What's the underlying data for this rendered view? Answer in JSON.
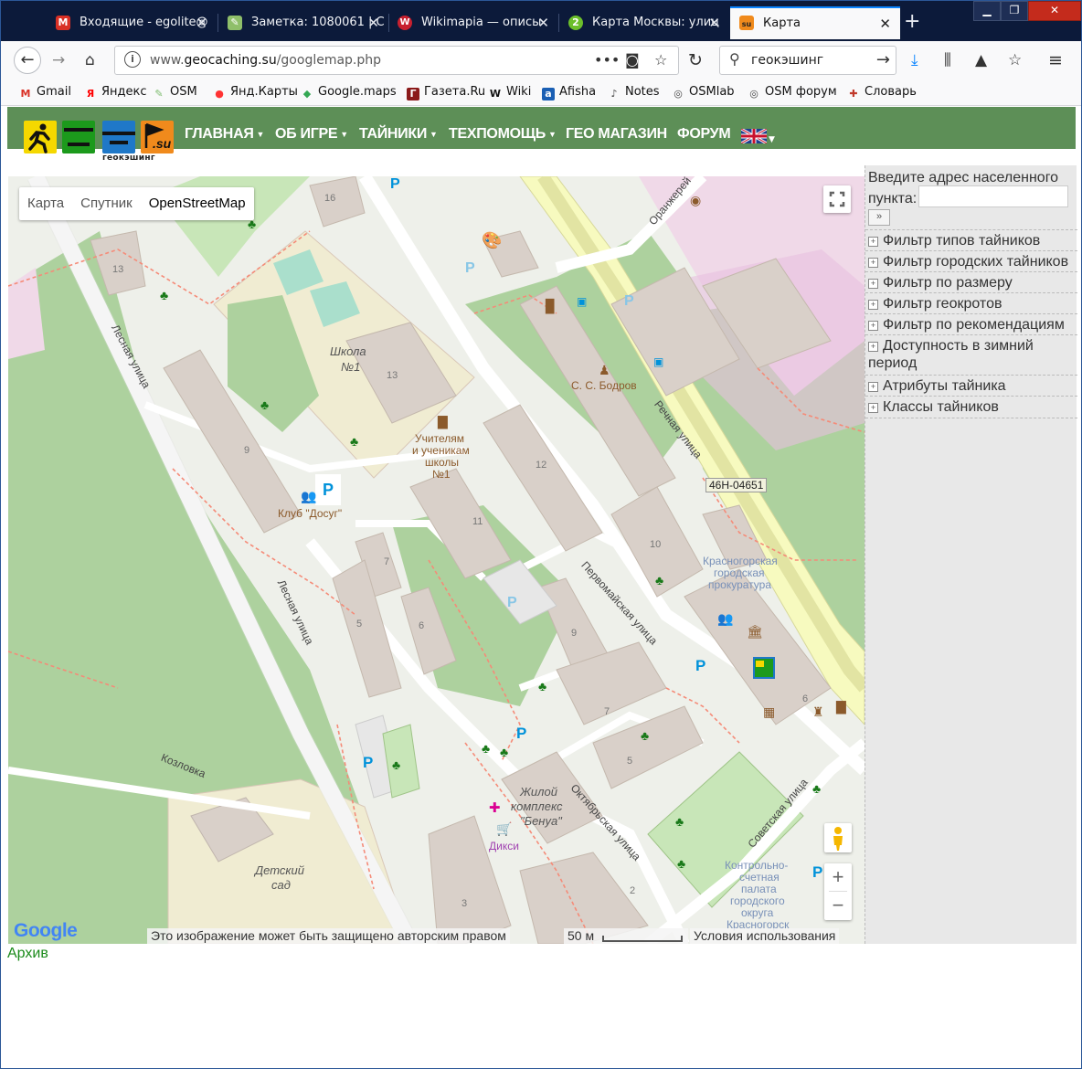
{
  "browser": {
    "tabs": [
      {
        "title": "Входящие - egolite@",
        "favicon_color": "#d93025",
        "favicon_glyph": "M"
      },
      {
        "title": "Заметка: 1080061 | С",
        "favicon_color": "#8fbf6a",
        "favicon_glyph": "✎"
      },
      {
        "title": "Wikimapia — описы",
        "favicon_color": "#c8202f",
        "favicon_glyph": "W"
      },
      {
        "title": "Карта Москвы: улиц",
        "favicon_color": "#6cbf2b",
        "favicon_glyph": "2"
      },
      {
        "title": "Карта",
        "favicon_color": "#f08a1c",
        "favicon_glyph": "su",
        "active": true
      }
    ],
    "url_prefix": "www.",
    "url_domain": "geocaching.su",
    "url_path": "/googlemap.php",
    "search_value": "геокэшинг",
    "bookmarks": [
      {
        "label": "Gmail",
        "icon_color": "#d93025",
        "glyph": "M"
      },
      {
        "label": "Яндекс",
        "icon_color": "#ff0000",
        "glyph": "Я"
      },
      {
        "label": "OSM",
        "icon_color": "#7ebc6f",
        "glyph": "✎"
      },
      {
        "label": "Янд.Карты",
        "icon_color": "#ff3333",
        "glyph": "●"
      },
      {
        "label": "Google.maps",
        "icon_color": "#34a853",
        "glyph": "◆"
      },
      {
        "label": "Газета.Ru",
        "icon_color": "#8b1a1a",
        "glyph": "Г"
      },
      {
        "label": "Wiki",
        "icon_color": "#ffffff",
        "glyph": "W"
      },
      {
        "label": "Afisha",
        "icon_color": "#1a5fb4",
        "glyph": "a"
      },
      {
        "label": "Notes",
        "icon_color": "#ffffff",
        "glyph": "♪"
      },
      {
        "label": "OSMlab",
        "icon_color": "#ffffff",
        "glyph": "◎"
      },
      {
        "label": "OSM форум",
        "icon_color": "#ffffff",
        "glyph": "◎"
      },
      {
        "label": "Словарь",
        "icon_color": "#c0392b",
        "glyph": "✚"
      }
    ]
  },
  "site": {
    "logo_caption": "геокэшинг",
    "logo_badge": ".su",
    "menu": [
      {
        "label": "ГЛАВНАЯ",
        "dropdown": true
      },
      {
        "label": "ОБ ИГРЕ",
        "dropdown": true
      },
      {
        "label": "ТАЙНИКИ",
        "dropdown": true
      },
      {
        "label": "ТЕХПОМОЩЬ",
        "dropdown": true
      },
      {
        "label": "ГЕО МАГАЗИН",
        "dropdown": false
      },
      {
        "label": "ФОРУМ",
        "dropdown": false
      }
    ]
  },
  "map": {
    "type_buttons": [
      "Карта",
      "Спутник",
      "OpenStreetMap"
    ],
    "selected_type": "OpenStreetMap",
    "zoom_in": "+",
    "zoom_out": "−",
    "copyright": "Это изображение может быть защищено авторским правом",
    "scale_label": "50 м",
    "terms": "Условия использования",
    "google": "Google",
    "labels": {
      "street_lesnaya": "Лесная улица",
      "street_rechnaya": "Речная улица",
      "street_pervomayskaya": "Первомайская улица",
      "street_oktyabrskaya": "Октябрьская улица",
      "street_sovetskaya": "Советская улица",
      "street_kozlovka": "Козловка",
      "street_oranzhereynaya": "Оранжерей",
      "school": "Школа",
      "school_no": "№1",
      "monument_line1": "Учителям",
      "monument_line2": "и ученикам",
      "monument_line3": "школы",
      "monument_line4": "№1",
      "club": "Клуб \"Досуг\"",
      "bodrov": "С. С. Бодров",
      "road_ref": "46Н-04651",
      "prok_line1": "Красногорская",
      "prok_line2": "городская",
      "prok_line3": "прокуратура",
      "zhk_line1": "Жилой",
      "zhk_line2": "комплекс",
      "zhk_line3": "\"Бенуа\"",
      "dixy": "Дикси",
      "kindergarten_line1": "Детский",
      "kindergarten_line2": "сад",
      "kontrol_line1": "Контрольно-",
      "kontrol_line2": "счетная",
      "kontrol_line3": "палата",
      "kontrol_line4": "городского",
      "kontrol_line5": "округа",
      "kontrol_line6": "Красногорск",
      "h16": "16",
      "h13a": "13",
      "h13b": "13",
      "h9a": "9",
      "h12": "12",
      "h11": "11",
      "h10": "10",
      "h7a": "7",
      "h5a": "5",
      "h6a": "6",
      "h9b": "9",
      "h7b": "7",
      "h5b": "5",
      "h6b": "6",
      "h2": "2",
      "h3": "3"
    }
  },
  "sidebar": {
    "prompt": "Введите адрес населенного пункта:",
    "go_button": "»",
    "filters": [
      "Фильтр типов тайников",
      "Фильтр городских тайников",
      "Фильтр по размеру",
      "Фильтр геокротов",
      "Фильтр по рекомендациям",
      "Доступность в зимний период",
      "Атрибуты тайника",
      "Классы тайников"
    ]
  },
  "footer": {
    "archive_link": "Архив"
  }
}
